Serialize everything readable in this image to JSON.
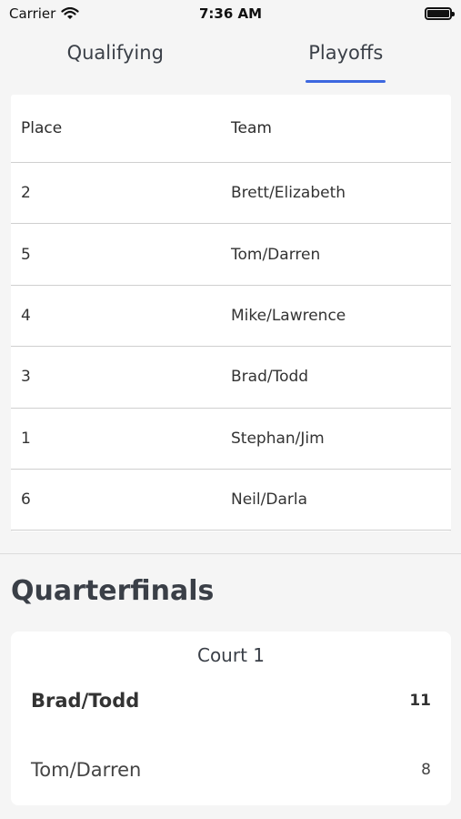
{
  "status_bar": {
    "carrier": "Carrier",
    "time": "7:36 AM"
  },
  "tabs": [
    {
      "label": "Qualifying",
      "active": false
    },
    {
      "label": "Playoffs",
      "active": true
    }
  ],
  "colors": {
    "accent": "#3d68e0",
    "background": "#f5f5f5",
    "card": "#ffffff"
  },
  "standings": {
    "headers": {
      "place": "Place",
      "team": "Team"
    },
    "rows": [
      {
        "place": "2",
        "team": "Brett/Elizabeth"
      },
      {
        "place": "5",
        "team": "Tom/Darren"
      },
      {
        "place": "4",
        "team": "Mike/Lawrence"
      },
      {
        "place": "3",
        "team": "Brad/Todd"
      },
      {
        "place": "1",
        "team": "Stephan/Jim"
      },
      {
        "place": "6",
        "team": "Neil/Darla"
      }
    ]
  },
  "quarterfinals": {
    "title": "Quarterfinals",
    "matches": [
      {
        "court": "Court 1",
        "winner": {
          "team": "Brad/Todd",
          "score": "11"
        },
        "loser": {
          "team": "Tom/Darren",
          "score": "8"
        }
      }
    ]
  }
}
